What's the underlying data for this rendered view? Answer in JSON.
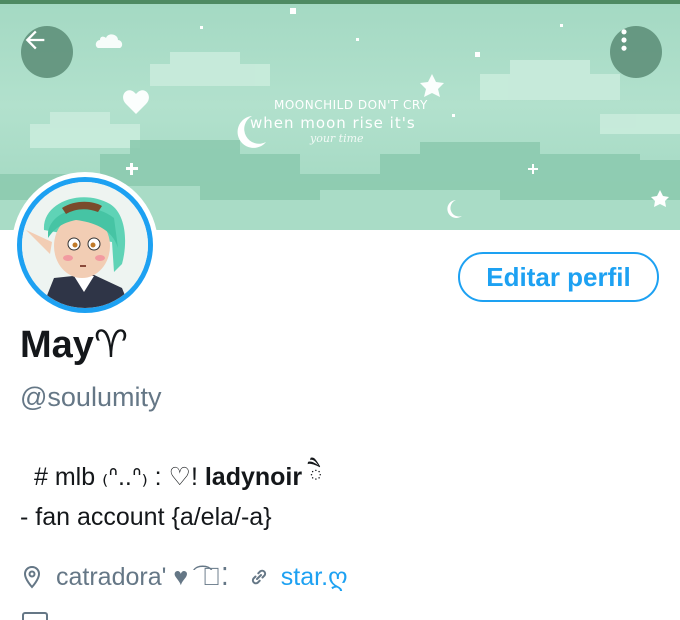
{
  "banner": {
    "line1": "MOONCHILD DON'T CRY",
    "line2": "when moon rise it's",
    "line3": "your time"
  },
  "profile": {
    "display_name": "May♈",
    "handle": "@soulumity",
    "edit_button": "Editar perfil"
  },
  "bio": {
    "line1_prefix": "#  mlb  ₍ᐢ..ᐢ₎  : ♡!  ",
    "line1_bold": "ladynoir",
    "line1_suffix": " ཻ",
    "line2": "-   fan account  {a/ela/-a}"
  },
  "meta": {
    "location": "catradora' ♥ ͡ ⃝⁚",
    "website": "star.ღ"
  },
  "icons": {
    "back": "arrow-left-icon",
    "more": "more-vertical-icon",
    "location": "location-pin-icon",
    "link": "link-icon"
  },
  "colors": {
    "accent": "#1da1f2",
    "muted": "#657786",
    "banner": "#a4d9c3"
  }
}
